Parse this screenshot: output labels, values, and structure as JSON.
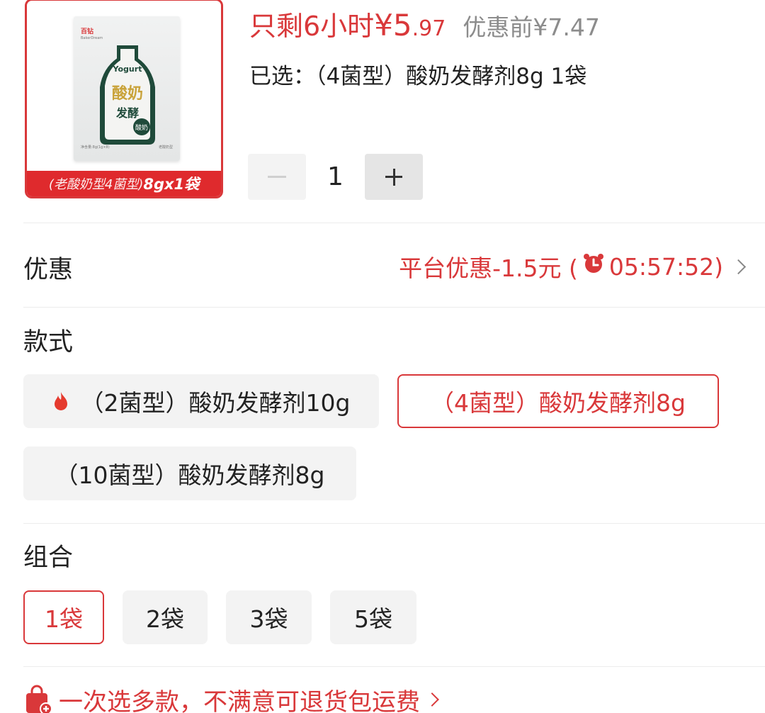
{
  "product": {
    "image_banner_light": "(老酸奶型4菌型)",
    "image_banner_bold": "8gx1袋",
    "package_brand": "百钻",
    "package_brand_en": "BakerDream",
    "package_sub": "酸奶发酵剂",
    "package_net": "净含量:8g(1g×8)",
    "package_type": "老酸奶型",
    "price_countdown": "只剩6小时",
    "price_integer": "¥5",
    "price_decimal": ".97",
    "price_original": "优惠前¥7.47",
    "selected_text": "已选：（4菌型）酸奶发酵剂8g 1袋"
  },
  "quantity": {
    "value": "1"
  },
  "discount": {
    "label": "优惠",
    "value_prefix": "平台优惠-1.5元 (",
    "timer": "05:57:52)"
  },
  "style_section": {
    "label": "款式",
    "options": [
      {
        "label": "（2菌型）酸奶发酵剂10g",
        "hot": true
      },
      {
        "label": "（4菌型）酸奶发酵剂8g",
        "selected": true
      },
      {
        "label": "（10菌型）酸奶发酵剂8g"
      }
    ]
  },
  "combo_section": {
    "label": "组合",
    "options": [
      {
        "label": "1袋",
        "selected": true
      },
      {
        "label": "2袋"
      },
      {
        "label": "3袋"
      },
      {
        "label": "5袋"
      }
    ]
  },
  "promo": {
    "text": "一次选多款，不满意可退货包运费"
  },
  "colors": {
    "accent": "#d9383a",
    "chip_bg": "#f3f3f3",
    "muted": "#8c8c8c"
  }
}
